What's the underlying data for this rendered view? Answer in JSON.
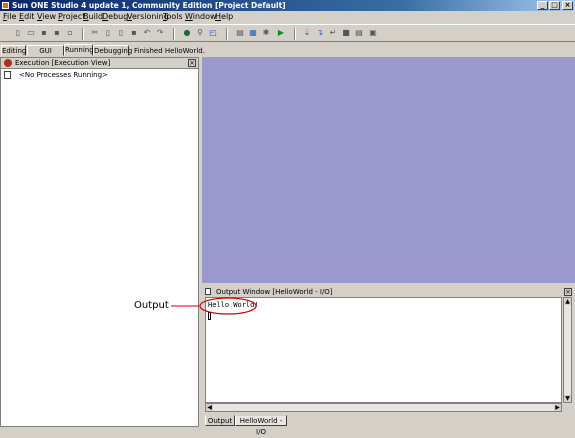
{
  "window": {
    "title": "Sun ONE Studio 4 update 1, Community Edition [Project Default]",
    "minimize": "_",
    "maximize": "□",
    "close": "×"
  },
  "menu": [
    "File",
    "Edit",
    "View",
    "Project",
    "Build",
    "Debug",
    "Versioning",
    "Tools",
    "Window",
    "Help"
  ],
  "workspaces": {
    "tabs": [
      "Editing",
      "GUI Editing",
      "Running",
      "Debugging"
    ],
    "active": "Running",
    "status": "Finished HelloWorld."
  },
  "execution_view": {
    "title": "Execution [Execution View]",
    "empty_message": "<No Processes Running>"
  },
  "output_window": {
    "title": "Output Window [HelloWorld - I/O]",
    "output_text": "Hello World!",
    "tabs": [
      "Output",
      "HelloWorld - I/O"
    ],
    "active_tab": "HelloWorld - I/O"
  },
  "annotation": {
    "label": "Output",
    "color": "#cc0000"
  },
  "colors": {
    "title_bar": "#0a246a",
    "desktop": "#9999cc"
  }
}
